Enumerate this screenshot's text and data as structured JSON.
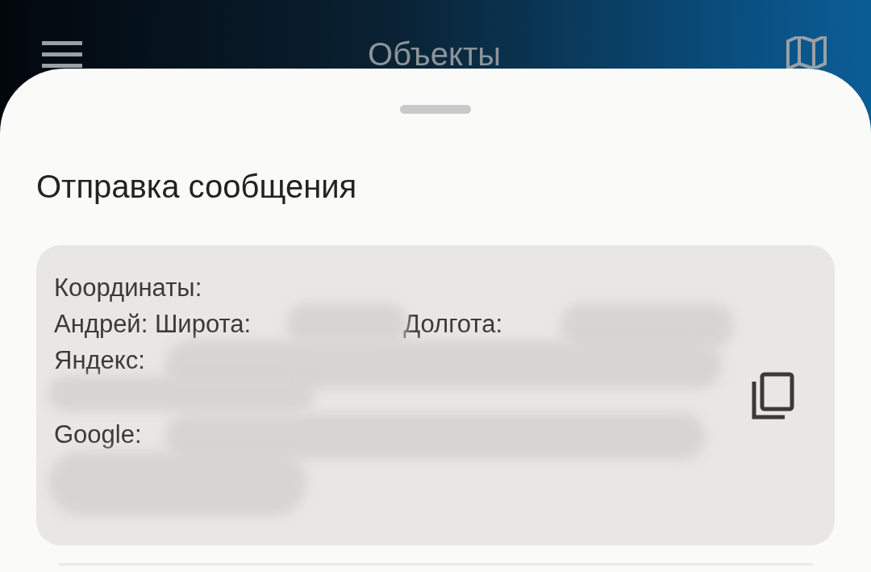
{
  "header": {
    "title": "Объекты"
  },
  "sheet": {
    "title": "Отправка сообщения",
    "card": {
      "lines": [
        {
          "parts": [
            "Координаты:"
          ]
        },
        {
          "parts": [
            "Андрей: Широта:",
            "Долгота:"
          ]
        },
        {
          "parts": [
            "Яндекс:"
          ]
        },
        {
          "parts": [
            "Google:"
          ]
        }
      ]
    }
  }
}
